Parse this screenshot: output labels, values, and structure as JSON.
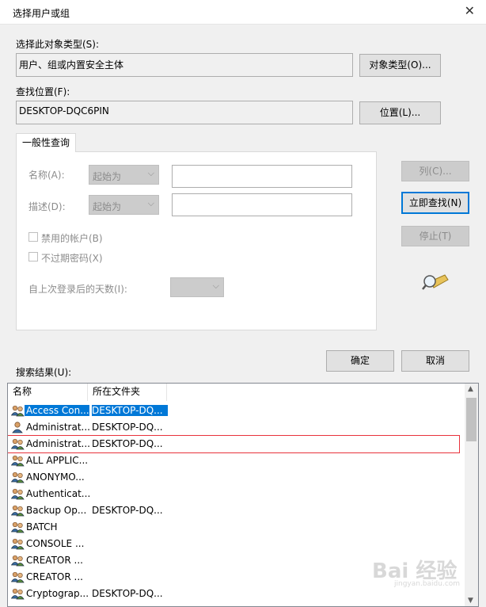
{
  "window": {
    "title": "选择用户或组",
    "close_glyph": "✕"
  },
  "object_types": {
    "label": "选择此对象类型(S):",
    "value": "用户、组或内置安全主体",
    "button": "对象类型(O)..."
  },
  "location": {
    "label": "查找位置(F):",
    "value": "DESKTOP-DQC6PIN",
    "button": "位置(L)..."
  },
  "tab": {
    "label": "一般性查询"
  },
  "query": {
    "name_label": "名称(A):",
    "name_mode": "起始为",
    "desc_label": "描述(D):",
    "desc_mode": "起始为",
    "disabled_accounts": "禁用的帐户(B)",
    "non_expiring": "不过期密码(X)",
    "days_label": "自上次登录后的天数(I):"
  },
  "side_buttons": {
    "columns": "列(C)...",
    "find_now": "立即查找(N)",
    "stop": "停止(T)"
  },
  "ok_button": "确定",
  "cancel_button": "取消",
  "results": {
    "label": "搜索结果(U):",
    "headers": [
      "名称",
      "所在文件夹"
    ],
    "rows": [
      {
        "name": "Access Con...",
        "folder": "DESKTOP-DQ...",
        "icon": "group-icon"
      },
      {
        "name": "Administrat...",
        "folder": "DESKTOP-DQ...",
        "icon": "user-icon"
      },
      {
        "name": "Administrat...",
        "folder": "DESKTOP-DQ...",
        "icon": "group-icon"
      },
      {
        "name": "ALL APPLIC...",
        "folder": "",
        "icon": "group-icon"
      },
      {
        "name": "ANONYMO...",
        "folder": "",
        "icon": "group-icon"
      },
      {
        "name": "Authenticat...",
        "folder": "",
        "icon": "group-icon"
      },
      {
        "name": "Backup Op...",
        "folder": "DESKTOP-DQ...",
        "icon": "group-icon"
      },
      {
        "name": "BATCH",
        "folder": "",
        "icon": "group-icon"
      },
      {
        "name": "CONSOLE ...",
        "folder": "",
        "icon": "group-icon"
      },
      {
        "name": "CREATOR ...",
        "folder": "",
        "icon": "group-icon"
      },
      {
        "name": "CREATOR ...",
        "folder": "",
        "icon": "group-icon"
      },
      {
        "name": "Cryptograp...",
        "folder": "DESKTOP-DQ...",
        "icon": "group-icon"
      }
    ]
  },
  "watermark": {
    "text": "Bai 经验",
    "sub": "jingyan.baidu.com"
  },
  "colors": {
    "accent": "#0078d7",
    "highlight_border": "#e8323c"
  }
}
